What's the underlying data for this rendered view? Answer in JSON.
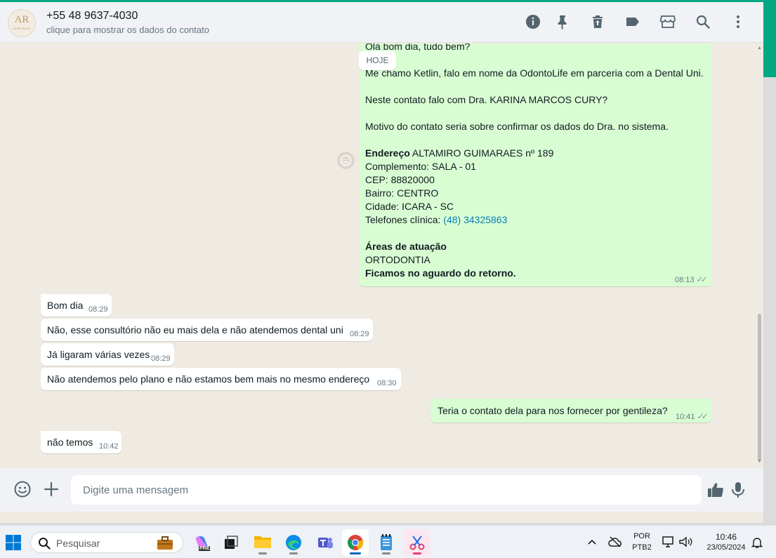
{
  "header": {
    "contact_name": "+55 48 9637-4030",
    "contact_subtitle": "clique para mostrar os dados do contato",
    "avatar_text": "AR",
    "avatar_subtext": "ALINE RECO"
  },
  "chat": {
    "date_badge": "HOJE",
    "outgoing_long": {
      "lines": [
        "Olá bom dia, tudo bem?",
        "Me chamo Ketlin, falo em nome da OdontoLife em parceria com a Dental Uni.",
        "Neste contato falo com Dra. KARINA MARCOS CURY?",
        "Motivo do contato seria sobre confirmar os dados do Dra. no sistema."
      ],
      "address_label": "Endereço",
      "address_value": " ALTAMIRO GUIMARAES nº 189",
      "complemento": "Complemento: SALA - 01",
      "cep": "CEP: 88820000",
      "bairro": "Bairro: CENTRO",
      "cidade": "Cidade: ICARA - SC",
      "telefone_label": "Telefones clínica: ",
      "telefone_value": "(48) 34325863",
      "areas_label": "Áreas de atuação",
      "areas_value": "ORTODONTIA",
      "closing": "Ficamos no aguardo do retorno.",
      "time": "08:13"
    },
    "incoming": [
      {
        "text": "Bom dia",
        "time": "08:29"
      },
      {
        "text": "Não, esse consultório não eu mais dela e não atendemos dental uni",
        "time": "08:29"
      },
      {
        "text": "Já ligaram várias vezes",
        "time": "08:29"
      },
      {
        "text": "Não atendemos pelo plano e não estamos bem mais no mesmo endereço",
        "time": "08:30"
      }
    ],
    "outgoing_short": {
      "text": "Teria o contato dela para nos fornecer por gentileza?",
      "time": "10:41"
    },
    "incoming_last": {
      "text": "não temos",
      "time": "10:42"
    }
  },
  "footer": {
    "placeholder": "Digite uma mensagem"
  },
  "taskbar": {
    "search_label": "Pesquisar",
    "lang_top": "POR",
    "lang_bottom": "PTB2",
    "clock_time": "10:46",
    "clock_date": "23/05/2024",
    "copilot_badge": "PRE"
  },
  "colors": {
    "accent": "#00a884",
    "outgoing_bubble": "#d9fdd3",
    "incoming_bubble": "#ffffff",
    "chat_background": "#efeae2",
    "link": "#027eb5"
  },
  "icons": [
    "info-icon",
    "pin-icon",
    "trash-icon",
    "label-icon",
    "shop-icon",
    "search-icon",
    "menu-icon",
    "emoji-icon",
    "plus-icon",
    "thumbs-up-icon",
    "mic-icon"
  ]
}
